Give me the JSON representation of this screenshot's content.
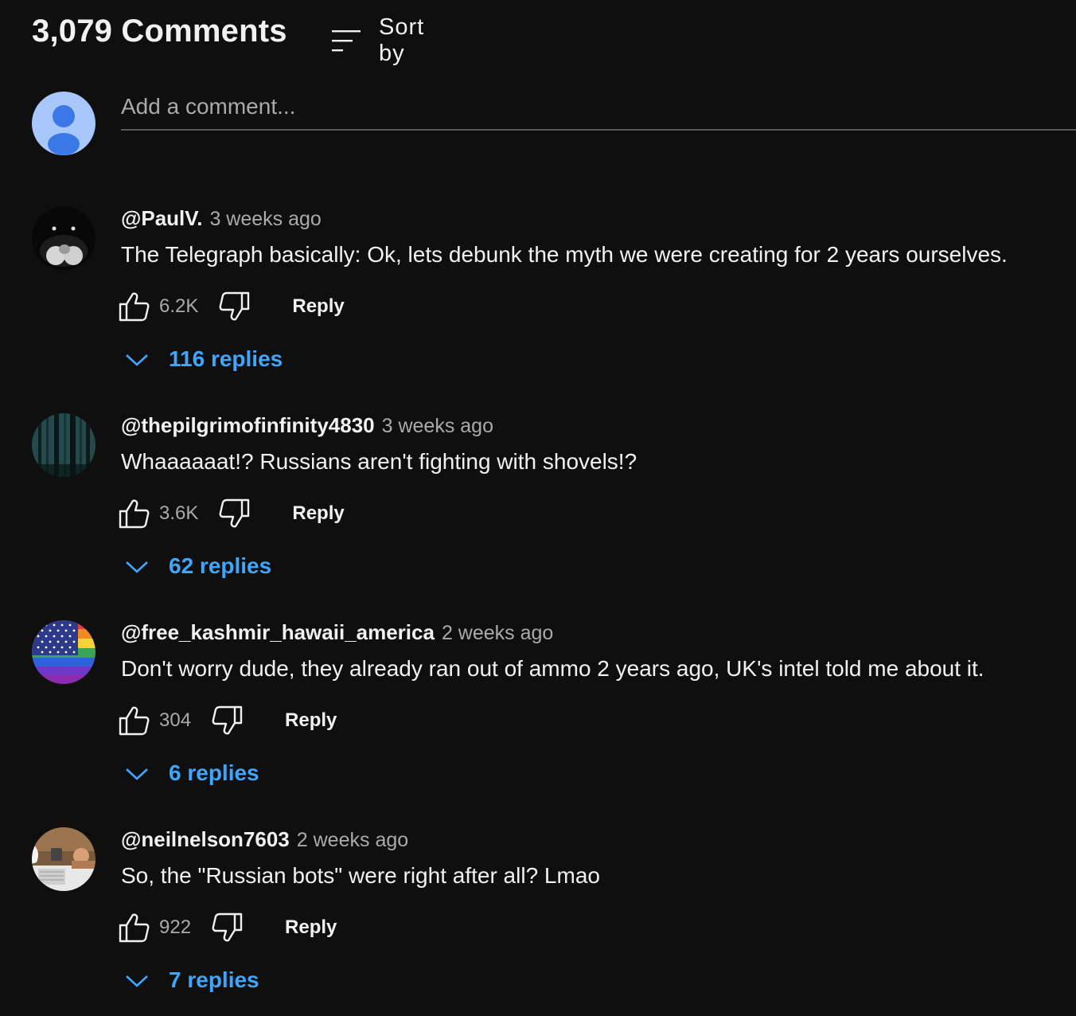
{
  "header": {
    "comment_count": "3,079 Comments",
    "sort_label": "Sort by"
  },
  "add_comment": {
    "placeholder": "Add a comment..."
  },
  "colors": {
    "background": "#0f0f0f",
    "text": "#f1f1f1",
    "secondary_text": "#aaaaaa",
    "link_blue": "#3ea6ff",
    "avatar_default": "#a8c7fa"
  },
  "icons": {
    "sort": "sort-icon",
    "like": "thumbs-up-icon",
    "dislike": "thumbs-down-icon",
    "expand": "chevron-down-icon",
    "default_avatar": "person-icon"
  },
  "comments": [
    {
      "author": "@PaulV.",
      "time": "3 weeks ago",
      "text": "The Telegraph basically: Ok, lets debunk the myth we were creating for 2 years ourselves.",
      "likes": "6.2K",
      "reply_label": "Reply",
      "replies_label": "116 replies"
    },
    {
      "author": "@thepilgrimofinfinity4830",
      "time": "3 weeks ago",
      "text": "Whaaaaaat!? Russians aren't fighting with shovels!?",
      "likes": "3.6K",
      "reply_label": "Reply",
      "replies_label": "62 replies"
    },
    {
      "author": "@free_kashmir_hawaii_america",
      "time": "2 weeks ago",
      "text": "Don't worry dude, they already ran out of ammo 2 years ago, UK's intel told me about it.",
      "likes": "304",
      "reply_label": "Reply",
      "replies_label": "6 replies"
    },
    {
      "author": "@neilnelson7603",
      "time": "2 weeks ago",
      "text": "So, the \"Russian bots\" were right after all? Lmao",
      "likes": "922",
      "reply_label": "Reply",
      "replies_label": "7 replies"
    }
  ]
}
